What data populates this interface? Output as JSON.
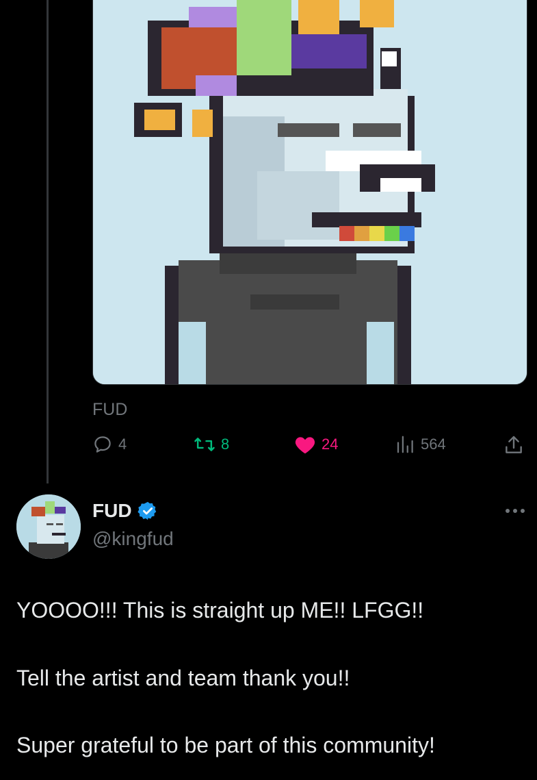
{
  "quoted_post": {
    "image_alt": "pixel art avatar with jester hat",
    "source_label": "FUD",
    "stats": {
      "replies": "4",
      "retweets": "8",
      "likes": "24",
      "views": "564"
    }
  },
  "post": {
    "display_name": "FUD",
    "handle": "@kingfud",
    "verified": true,
    "text_lines": [
      "YOOOO!!! This is straight up ME!! LFGG!!",
      "Tell the artist and team thank you!!",
      "Super grateful to be part of this community!"
    ]
  },
  "colors": {
    "background": "#000000",
    "text": "#e7e9ea",
    "muted": "#71767b",
    "retweet": "#00ba7c",
    "like": "#f91880",
    "verified": "#1d9bf0"
  },
  "icons": [
    "reply-icon",
    "retweet-icon",
    "heart-icon",
    "views-icon",
    "share-icon",
    "verified-icon",
    "more-icon"
  ]
}
